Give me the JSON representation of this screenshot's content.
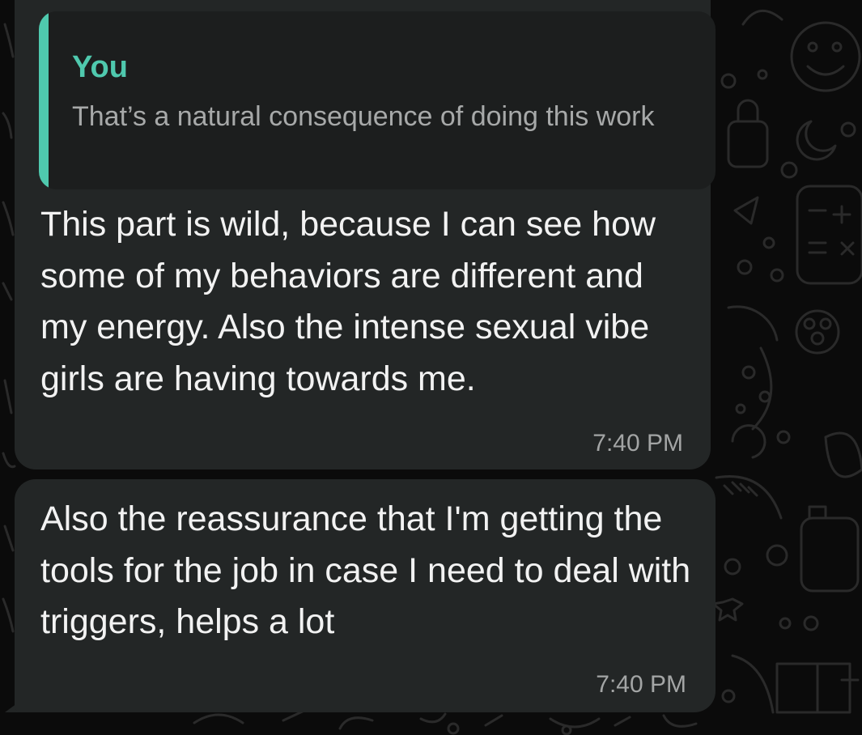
{
  "chat": {
    "messages": [
      {
        "reply_to": {
          "author": "You",
          "text": "That’s a natural consequence of doing this work"
        },
        "text": "This part is wild, because I can see how some of my behaviors are different and my energy. Also the intense sexual vibe girls are having towards me.",
        "time": "7:40 PM"
      },
      {
        "text": "Also the reassurance that I'm getting the tools for the job in case I need to deal with triggers, helps a lot",
        "time": "7:40 PM"
      }
    ]
  },
  "theme": {
    "background": "#0b0b0b",
    "bubble": "#232626",
    "quote_background": "#1c1e1e",
    "accent": "#4fc9ae",
    "text": "#f2f2f2",
    "muted_text": "#a3a5a5"
  }
}
